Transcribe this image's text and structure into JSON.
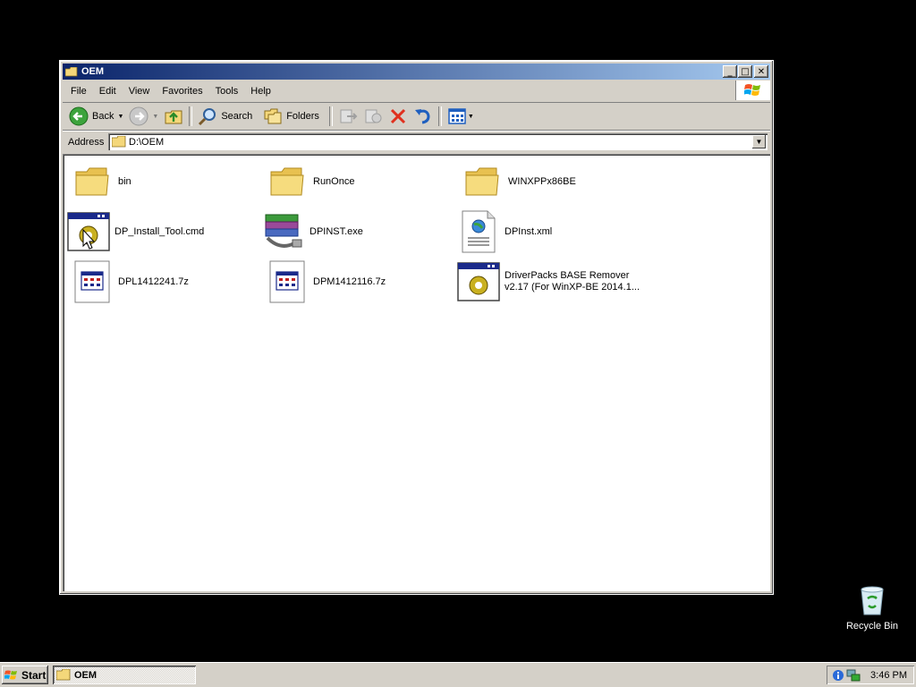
{
  "window": {
    "title": "OEM",
    "buttons": {
      "minimize": "_",
      "maximize": "□",
      "close": "✕"
    }
  },
  "menubar": {
    "items": [
      "File",
      "Edit",
      "View",
      "Favorites",
      "Tools",
      "Help"
    ]
  },
  "toolbar": {
    "back_label": "Back",
    "search_label": "Search",
    "folders_label": "Folders"
  },
  "address": {
    "label": "Address",
    "value": "D:\\OEM"
  },
  "files": [
    {
      "name": "bin",
      "icon": "folder-icon"
    },
    {
      "name": "RunOnce",
      "icon": "folder-icon"
    },
    {
      "name": "WINXPPx86BE",
      "icon": "folder-icon"
    },
    {
      "name": "DP_Install_Tool.cmd",
      "icon": "batch-file-icon"
    },
    {
      "name": "DPINST.exe",
      "icon": "installer-icon"
    },
    {
      "name": "DPInst.xml",
      "icon": "xml-file-icon"
    },
    {
      "name": "DPL1412241.7z",
      "icon": "archive-file-icon"
    },
    {
      "name": "DPM1412116.7z",
      "icon": "archive-file-icon"
    },
    {
      "name": "DriverPacks BASE Remover v2.17 (For WinXP-BE 2014.1...",
      "icon": "batch-file-icon"
    }
  ],
  "desktop": {
    "recycle_bin_label": "Recycle Bin"
  },
  "taskbar": {
    "start_label": "Start",
    "task_label": "OEM",
    "clock": "3:46 PM"
  }
}
